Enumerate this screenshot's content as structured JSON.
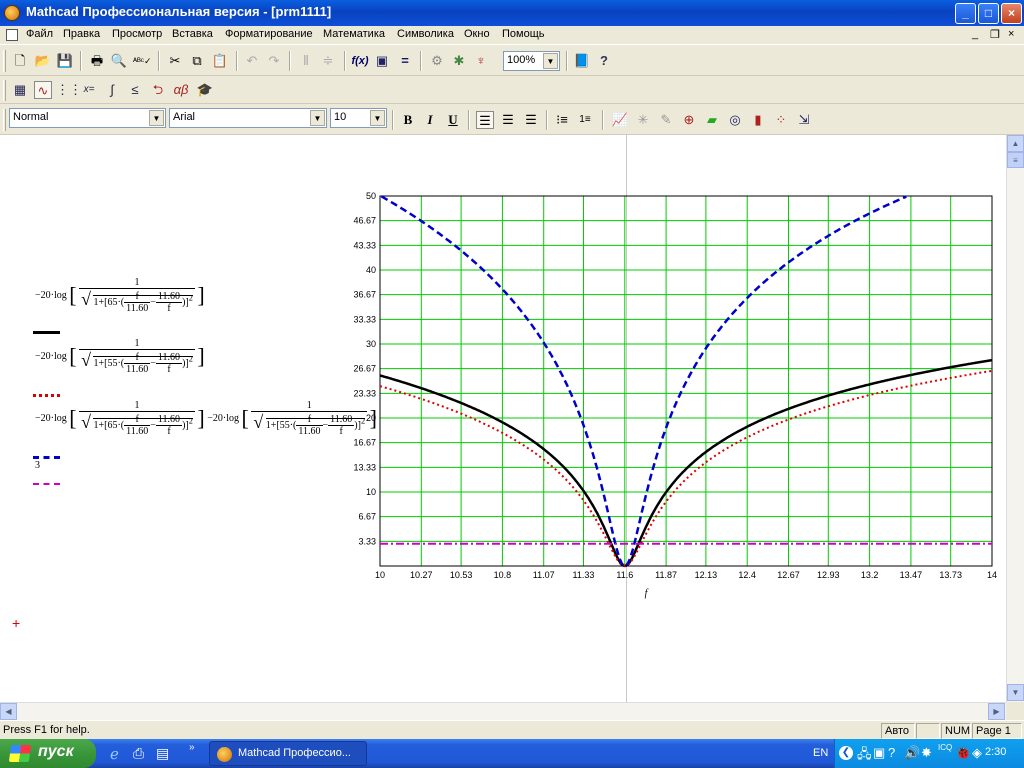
{
  "window": {
    "title": "Mathcad Профессиональная версия - [prm1111]",
    "minimize": "_",
    "maximize": "□",
    "close": "×"
  },
  "menubar": {
    "items": [
      "Файл",
      "Правка",
      "Просмотр",
      "Вставка",
      "Форматирование",
      "Математика",
      "Символика",
      "Окно",
      "Помощь"
    ],
    "mdi_min": "_",
    "mdi_restore": "❐",
    "mdi_close": "×"
  },
  "toolbar": {
    "zoom": "100%"
  },
  "formatbar": {
    "style": "Normal",
    "font": "Arial",
    "size": "10",
    "bold": "B",
    "italic": "I",
    "underline": "U"
  },
  "formulas": {
    "prefix": "−20·log",
    "one": "1",
    "one_plus": "1+",
    "coef1": "65·",
    "coef2": "55·",
    "f": "f",
    "f0": "11.60",
    "minus": "−",
    "sq": "2",
    "extra_value": "3"
  },
  "chart_data": {
    "type": "line",
    "xlabel": "f",
    "xlim": [
      10,
      14
    ],
    "ylim": [
      0,
      50
    ],
    "x_ticks": [
      "10",
      "10.27",
      "10.53",
      "10.8",
      "11.07",
      "11.33",
      "11.6",
      "11.87",
      "12.13",
      "12.4",
      "12.67",
      "12.93",
      "13.2",
      "13.47",
      "13.73",
      "14"
    ],
    "y_ticks": [
      "50",
      "46.67",
      "43.33",
      "40",
      "36.67",
      "33.33",
      "30",
      "26.67",
      "23.33",
      "20",
      "16.67",
      "13.33",
      "10",
      "6.67",
      "3.33"
    ],
    "grid": true,
    "grid_color": "#00cc00",
    "f0": 11.6,
    "series": [
      {
        "coef": 65,
        "color": "#000000",
        "style": "solid"
      },
      {
        "coef": 55,
        "color": "#dd0000",
        "style": "dotted"
      },
      {
        "coef": "65+55",
        "color": "#0000cc",
        "style": "dashed"
      },
      {
        "constant": 3,
        "color": "#cc00cc",
        "style": "dashdot"
      }
    ]
  },
  "statusbar": {
    "help": "Press F1 for help.",
    "mode": "Авто",
    "num": "NUM",
    "page": "Page 1"
  },
  "taskbar": {
    "start": "пуск",
    "task": "Mathcad Профессио...",
    "lang": "EN",
    "clock": "2:30"
  }
}
